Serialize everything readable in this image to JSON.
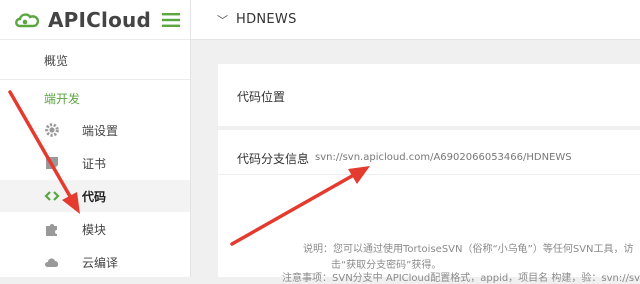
{
  "brand": {
    "name": "APICloud"
  },
  "header": {
    "project": "HDNEWS"
  },
  "sidebar": {
    "overview": "概览",
    "dev": "端开发",
    "items": [
      {
        "label": "端设置",
        "icon": "gear-icon"
      },
      {
        "label": "证书",
        "icon": "certificate-icon"
      },
      {
        "label": "代码",
        "icon": "code-icon"
      },
      {
        "label": "模块",
        "icon": "puzzle-icon"
      },
      {
        "label": "云编译",
        "icon": "cloud-icon"
      }
    ]
  },
  "main": {
    "code_location_label": "代码位置",
    "branch_info_label": "代码分支信息",
    "svn_url": "svn://svn.apicloud.com/A6902066053466/HDNEWS",
    "desc_line1": "说明：您可以通过使用TortoiseSVN（俗称“小乌龟”）等任何SVN工具，访",
    "desc_line2": "击“获取分支密码”获得。",
    "note": "注意事项：SVN分支中 APICloud配置格式，appid，项目名 构建，验：svn://svn"
  },
  "colors": {
    "accent_green": "#5aa640",
    "arrow_red": "#e53a2e"
  }
}
